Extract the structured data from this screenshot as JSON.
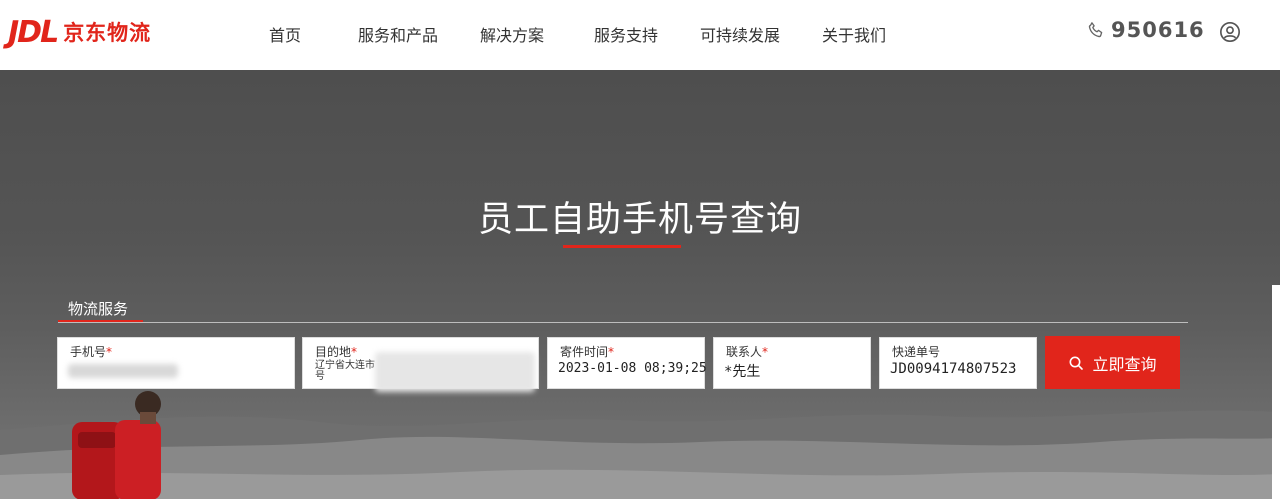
{
  "brand": {
    "mark": "JDL",
    "name": "京东物流",
    "accent": "#e1251b"
  },
  "nav": [
    {
      "label": "首页"
    },
    {
      "label": "服务和产品"
    },
    {
      "label": "解决方案"
    },
    {
      "label": "服务支持"
    },
    {
      "label": "可持续发展"
    },
    {
      "label": "关于我们"
    }
  ],
  "header": {
    "phone": "950616",
    "phone_icon": "phone-icon",
    "user_icon": "user-icon"
  },
  "hero": {
    "title": "员工自助手机号查询"
  },
  "tab": {
    "label": "物流服务"
  },
  "form": {
    "phone": {
      "label": "手机号",
      "required": "*"
    },
    "destination": {
      "label": "目的地",
      "required": "*",
      "value": "辽宁省大连市 号"
    },
    "send_time": {
      "label": "寄件时间",
      "required": "*",
      "value": "2023-01-08 08;39;25"
    },
    "contact": {
      "label": "联系人",
      "required": "*",
      "value": "*先生"
    },
    "tracking": {
      "label": "快递单号",
      "value": "JD0094174807523"
    }
  },
  "query_button": {
    "label": "立即查询",
    "icon": "search-icon"
  }
}
